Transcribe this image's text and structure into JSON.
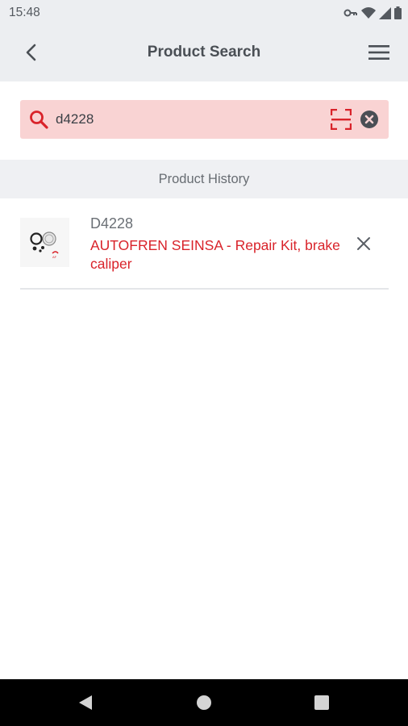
{
  "status_bar": {
    "time": "15:48",
    "icons": [
      "vpn-key-icon",
      "wifi-icon",
      "signal-icon",
      "battery-icon"
    ]
  },
  "app_bar": {
    "title": "Product Search",
    "back_icon": "chevron-left-icon",
    "menu_icon": "hamburger-menu-icon"
  },
  "search": {
    "value": "d4228",
    "placeholder": "",
    "icon": "search-icon",
    "scan_icon": "barcode-scan-icon",
    "clear_icon": "clear-circle-icon"
  },
  "history": {
    "title": "Product History",
    "items": [
      {
        "code": "D4228",
        "description": "AUTOFREN SEINSA - Repair Kit, brake caliper",
        "thumbnail": "repair-kit-thumbnail"
      }
    ]
  },
  "nav_bar": {
    "buttons": [
      "nav-back-icon",
      "nav-home-icon",
      "nav-recents-icon"
    ]
  },
  "colors": {
    "accent": "#d9232a",
    "search_bg": "#f9d3d3",
    "app_bar_bg": "#eceef1",
    "history_header_bg": "#eff0f3",
    "nav_bar_bg": "#000000"
  }
}
